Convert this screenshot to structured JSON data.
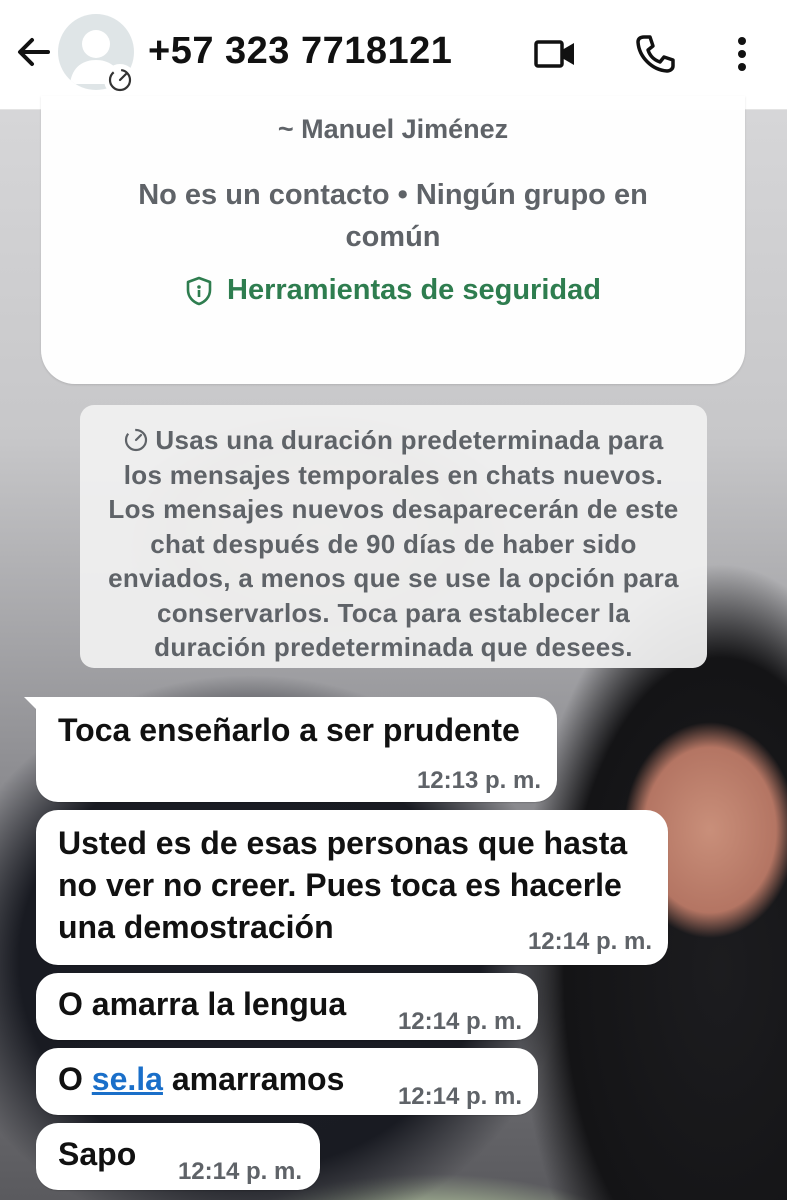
{
  "header": {
    "title": "+57 323 7718121",
    "back_icon": "arrow-left-icon",
    "video_icon": "video-camera-icon",
    "call_icon": "phone-icon",
    "more_icon": "more-vertical-icon"
  },
  "info_card": {
    "name": "~ Manuel Jiménez",
    "status": "No es un contacto • Ningún grupo en común",
    "safety_label": "Herramientas de seguridad"
  },
  "system_note": {
    "text": "Usas una duración predeterminada para los mensajes temporales en chats nuevos. Los mensajes nuevos desaparecerán de este chat después de 90 días de haber sido enviados, a menos que se use la opción para conservarlos. Toca para establecer la duración predeterminada que desees."
  },
  "messages": [
    {
      "text": "Toca enseñarlo a ser prudente",
      "time": "12:13 p. m."
    },
    {
      "text": "Usted es de esas personas que hasta no ver no creer. Pues toca es hacerle una demostración",
      "time": "12:14 p. m."
    },
    {
      "text": "O amarra la lengua",
      "time": "12:14 p. m."
    },
    {
      "text_prefix": "O ",
      "link": "se.la",
      "text_suffix": " amarramos",
      "time": "12:14 p. m."
    },
    {
      "text": "Sapo",
      "time": "12:14 p. m."
    }
  ],
  "colors": {
    "accent_green": "#2e7d4f",
    "link_blue": "#1a6fc9",
    "bubble": "#ffffff"
  }
}
